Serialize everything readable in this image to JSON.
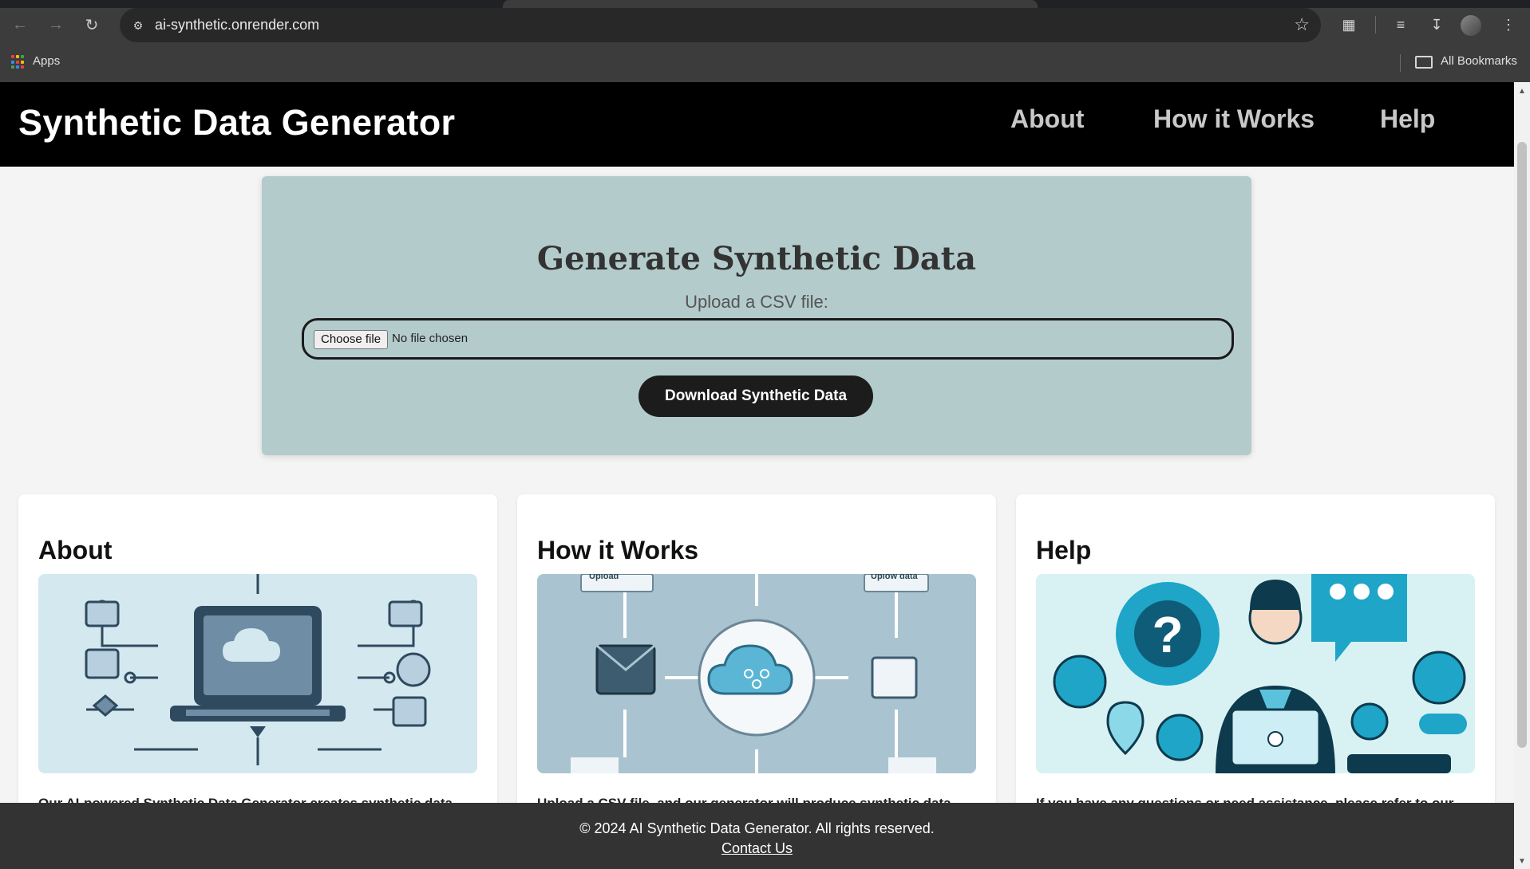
{
  "browser": {
    "url": "ai-synthetic.onrender.com",
    "bookmarks": {
      "apps_label": "Apps",
      "all_bookmarks_label": "All Bookmarks"
    },
    "icons": [
      "back-icon",
      "forward-icon",
      "reload-icon",
      "site-info-icon",
      "star-icon",
      "extensions-icon",
      "reading-list-icon",
      "download-icon",
      "menu-icon"
    ]
  },
  "header": {
    "brand": "Synthetic Data Generator",
    "nav": [
      "About",
      "How it Works",
      "Help"
    ]
  },
  "hero": {
    "title": "Generate Synthetic Data",
    "upload_label": "Upload a CSV file:",
    "file_button": "Choose file",
    "file_status": "No file chosen",
    "download_button": "Download Synthetic Data"
  },
  "cards": [
    {
      "title": "About",
      "text": "Our AI-powered Synthetic Data Generator creates synthetic data",
      "illustration": "laptop-cloud-illustration"
    },
    {
      "title": "How it Works",
      "text": "Upload a CSV file, and our generator will produce synthetic data",
      "illustration": "cloud-network-illustration",
      "labels": [
        "Upload",
        "Uplow data"
      ]
    },
    {
      "title": "Help",
      "text": "If you have any questions or need assistance, please refer to our",
      "illustration": "support-agent-illustration"
    }
  ],
  "footer": {
    "copyright": "© 2024 AI Synthetic Data Generator. All rights reserved.",
    "contact": "Contact Us"
  },
  "colors": {
    "header_bg": "#000000",
    "hero_bg": "#b4cbcc",
    "button_bg": "#1c1c1c",
    "footer_bg": "#333333",
    "page_bg": "#f4f4f4"
  }
}
